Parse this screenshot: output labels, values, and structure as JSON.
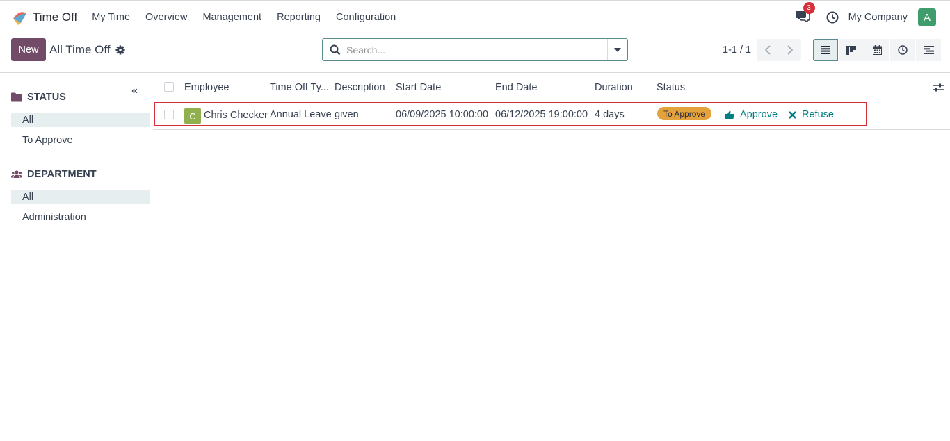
{
  "navbar": {
    "app_name": "Time Off",
    "menu": [
      "My Time",
      "Overview",
      "Management",
      "Reporting",
      "Configuration"
    ],
    "message_count": "3",
    "company": "My Company",
    "user_initial": "A"
  },
  "control_panel": {
    "new_label": "New",
    "title": "All Time Off",
    "search_placeholder": "Search...",
    "pager": "1-1 / 1",
    "views": [
      "list-view",
      "kanban-view",
      "calendar-view",
      "activity-view",
      "gantt-view"
    ]
  },
  "sidebar": {
    "status": {
      "title": "STATUS",
      "items": [
        "All",
        "To Approve"
      ]
    },
    "department": {
      "title": "DEPARTMENT",
      "items": [
        "All",
        "Administration"
      ]
    }
  },
  "table": {
    "headers": [
      "Employee",
      "Time Off Ty...",
      "Description",
      "Start Date",
      "End Date",
      "Duration",
      "Status"
    ],
    "rows": [
      {
        "initial": "C",
        "employee": "Chris Checker",
        "type": "Annual Leave",
        "description": "given",
        "start": "06/09/2025 10:00:00",
        "end": "06/12/2025 19:00:00",
        "duration": "4 days",
        "status": "To Approve",
        "approve_label": "Approve",
        "refuse_label": "Refuse"
      }
    ]
  },
  "colors": {
    "primary": "#714b67",
    "accent": "#017e84",
    "status_to_approve": "#e4a23c",
    "highlight": "#d6303b"
  }
}
